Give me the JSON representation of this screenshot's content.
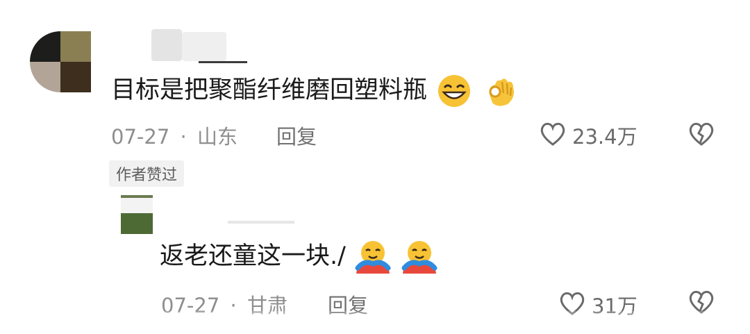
{
  "comment": {
    "text": "目标是把聚酯纤维磨回塑料瓶",
    "emojis": [
      "grinning-squint-emoji",
      "ok-hand-emoji"
    ],
    "date": "07-27",
    "separator": "·",
    "location": "山东",
    "reply_label": "回复",
    "like_count": "23.4万",
    "author_liked_badge": "作者赞过"
  },
  "reply": {
    "text": "返老还童这一块./",
    "emojis": [
      "hugging-emoji",
      "hugging-emoji"
    ],
    "date": "07-27",
    "separator": "·",
    "location": "甘肃",
    "reply_label": "回复",
    "like_count": "31万"
  },
  "colors": {
    "text": "#1a1a1a",
    "meta": "#8e8e8e",
    "badge_bg": "#f1f1f1",
    "icon": "#6a6a6a"
  }
}
